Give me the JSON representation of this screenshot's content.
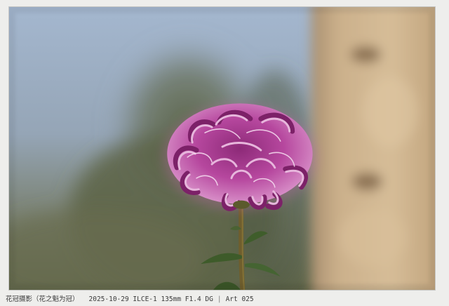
{
  "caption": {
    "title": "花冠摄影（花之魁为冠）",
    "exif": "2025-10-29 ILCE-1 135mm F1.4 DG",
    "separator": "|",
    "series": "Art 025"
  },
  "colors": {
    "frame_background": "#eeeeec",
    "sky": "#9fb0c4",
    "foliage": "#5d6448",
    "stone": "#cfb38c",
    "petal": "#b6479e",
    "petal_highlight": "#e7b6dc",
    "stem": "#6a5a2e",
    "leaf": "#3e5b2a"
  },
  "photo": {
    "subject": "flower-photo"
  }
}
